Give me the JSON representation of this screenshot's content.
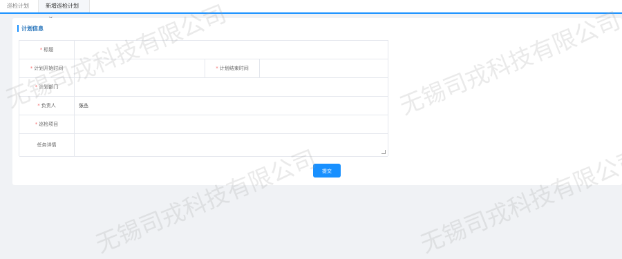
{
  "tabs": [
    {
      "label": "巡检计划"
    },
    {
      "label": "新增巡检计划",
      "close": "×"
    }
  ],
  "section": {
    "title": "计划信息"
  },
  "form": {
    "title_label": "标题",
    "start_time_label": "计划开始时间",
    "end_time_label": "计划结束时间",
    "department_label": "计划部门",
    "owner_label": "负责人",
    "owner_value": "张丛",
    "project_label": "巡检项目",
    "detail_label": "任务详情",
    "required_mark": "*"
  },
  "actions": {
    "submit_label": "提交"
  },
  "watermark": {
    "text": "无锡司戎科技有限公司"
  },
  "colors": {
    "accent": "#1890ff",
    "required": "#f56c6c"
  }
}
